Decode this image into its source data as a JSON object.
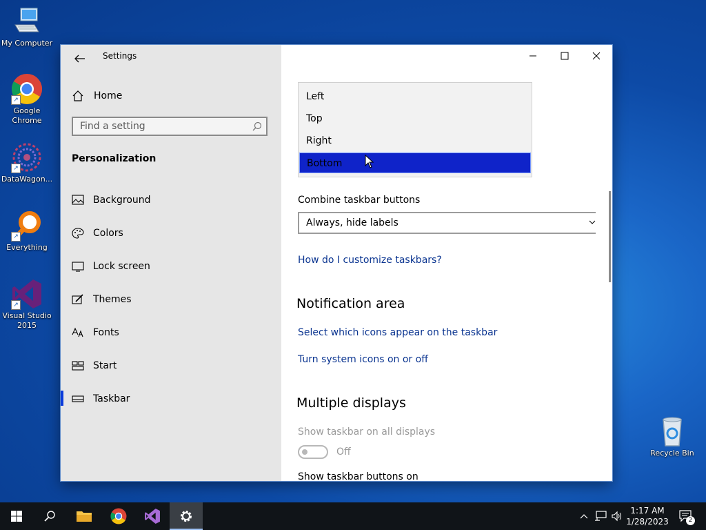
{
  "desktop": {
    "icons": [
      {
        "label": "My Computer"
      },
      {
        "label": "Google Chrome"
      },
      {
        "label": "DataWagon..."
      },
      {
        "label": "Everything"
      },
      {
        "label": "Visual Studio 2015"
      },
      {
        "label": "Recycle Bin"
      }
    ]
  },
  "window": {
    "title": "Settings",
    "controls": {
      "minimize": "minimize-icon",
      "maximize": "maximize-icon",
      "close": "close-icon"
    }
  },
  "sidebar": {
    "home_label": "Home",
    "search_placeholder": "Find a setting",
    "section_title": "Personalization",
    "items": [
      {
        "label": "Background",
        "icon": "picture-icon"
      },
      {
        "label": "Colors",
        "icon": "palette-icon"
      },
      {
        "label": "Lock screen",
        "icon": "lock-screen-icon"
      },
      {
        "label": "Themes",
        "icon": "brush-icon"
      },
      {
        "label": "Fonts",
        "icon": "font-icon"
      },
      {
        "label": "Start",
        "icon": "start-icon"
      },
      {
        "label": "Taskbar",
        "icon": "taskbar-icon",
        "selected": true
      }
    ]
  },
  "main": {
    "location_dropdown": {
      "options": [
        "Left",
        "Top",
        "Right",
        "Bottom"
      ],
      "selected": "Bottom"
    },
    "combine_label": "Combine taskbar buttons",
    "combine_value": "Always, hide labels",
    "customize_link": "How do I customize taskbars?",
    "notification_heading": "Notification area",
    "notif_link_1": "Select which icons appear on the taskbar",
    "notif_link_2": "Turn system icons on or off",
    "multiple_heading": "Multiple displays",
    "show_all_label": "Show taskbar on all displays",
    "toggle_state": "Off",
    "show_buttons_label": "Show taskbar buttons on"
  },
  "taskbar": {
    "time": "1:17 AM",
    "date": "1/28/2023",
    "notification_count": "2"
  },
  "colors": {
    "accent": "#0a3bdb",
    "selection": "#0f23c9",
    "link": "#0a3490"
  }
}
